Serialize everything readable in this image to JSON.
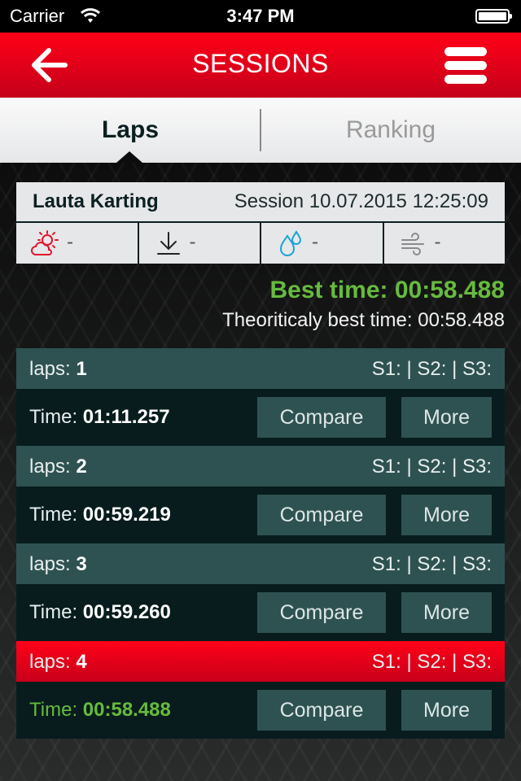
{
  "status_bar": {
    "carrier": "Carrier",
    "time": "3:47 PM",
    "wifi_icon": "wifi-icon",
    "battery_icon": "battery-icon"
  },
  "nav": {
    "title": "SESSIONS",
    "back_icon": "arrow-left-icon",
    "menu_icon": "hamburger-menu-icon"
  },
  "tabs": [
    {
      "label": "Laps",
      "active": true
    },
    {
      "label": "Ranking",
      "active": false
    }
  ],
  "session": {
    "track": "Lauta Karting",
    "session_label": "Session 10.07.2015 12:25:09",
    "weather": [
      {
        "icon": "partly-sunny-cloud-icon",
        "value": "-",
        "color": "#e3142b"
      },
      {
        "icon": "pressure-down-arrow-icon",
        "value": "-",
        "color": "#222222"
      },
      {
        "icon": "humidity-drops-icon",
        "value": "-",
        "color": "#1aa3d6"
      },
      {
        "icon": "wind-icon",
        "value": "-",
        "color": "#8a8a8a"
      }
    ]
  },
  "summary": {
    "best_time": "Best time: 00:58.488",
    "theoretical_best_time": "Theoriticaly best time: 00:58.488"
  },
  "laps": [
    {
      "label": "laps: ",
      "number": "1",
      "sectors": "S1: | S2: | S3:",
      "time_label": "Time: ",
      "time": "01:11.257",
      "best": false,
      "compare": "Compare",
      "more": "More"
    },
    {
      "label": "laps: ",
      "number": "2",
      "sectors": "S1: | S2: | S3:",
      "time_label": "Time: ",
      "time": "00:59.219",
      "best": false,
      "compare": "Compare",
      "more": "More"
    },
    {
      "label": "laps: ",
      "number": "3",
      "sectors": "S1: | S2: | S3:",
      "time_label": "Time: ",
      "time": "00:59.260",
      "best": false,
      "compare": "Compare",
      "more": "More"
    },
    {
      "label": "laps: ",
      "number": "4",
      "sectors": "S1: | S2: | S3:",
      "time_label": "Time: ",
      "time": "00:58.488",
      "best": true,
      "compare": "Compare",
      "more": "More"
    }
  ],
  "colors": {
    "brand_red": "#ff0018",
    "best_green": "#66bb3e",
    "row_teal": "#2e5251",
    "row_dark": "#081c1d"
  }
}
